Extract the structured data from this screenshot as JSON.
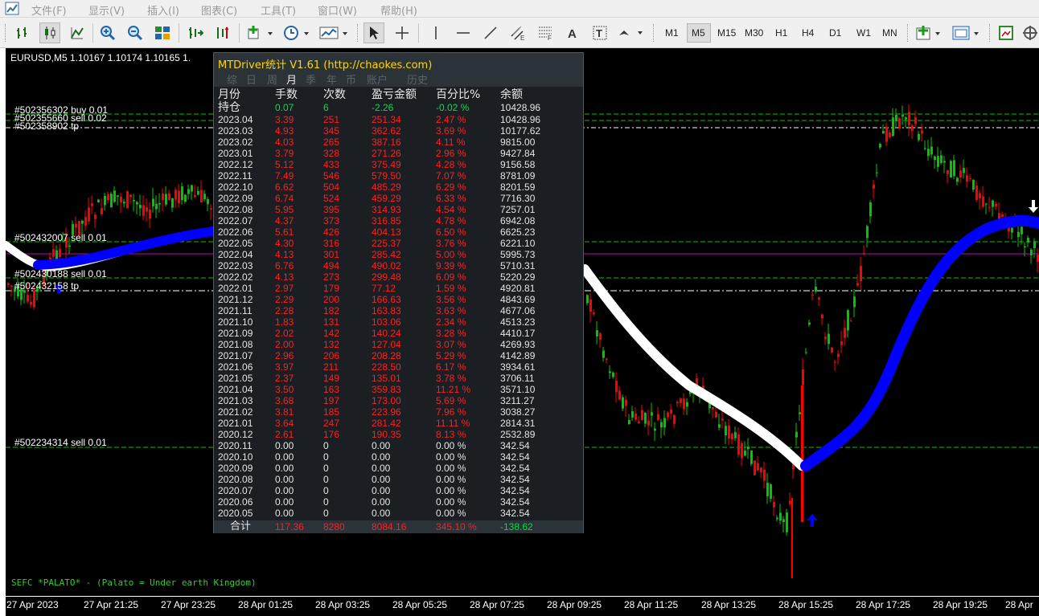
{
  "menubar": {
    "items": [
      "文件(F)",
      "显示(V)",
      "插入(I)",
      "图表(C)",
      "工具(T)",
      "窗口(W)",
      "帮助(H)"
    ]
  },
  "toolbar": {
    "timeframes": [
      "M1",
      "M5",
      "M15",
      "M30",
      "H1",
      "H4",
      "D1",
      "W1",
      "MN"
    ],
    "active_timeframe": "M5",
    "tools": [
      "bar-chart-icon",
      "candlestick-icon",
      "line-chart-icon",
      "zoom-in-icon",
      "zoom-out-icon",
      "tile-windows-icon",
      "auto-scroll-icon",
      "chart-shift-icon",
      "indicators-icon",
      "periods-icon",
      "templates-icon",
      "cursor-icon",
      "crosshair-icon",
      "vertical-line-icon",
      "horizontal-line-icon",
      "trendline-icon",
      "fibonacci-icon",
      "channel-icon",
      "text-icon",
      "text-label-icon",
      "arrows-icon",
      "new-chart-icon",
      "profiles-icon",
      "screenshot-icon",
      "strategy-tester-icon"
    ]
  },
  "chart": {
    "symbol_info": "EURUSD,M5  1.10167 1.10174 1.10165 1.",
    "order_labels": [
      "#502356302 buy 0.01",
      "#502355660 sell 0.02",
      "#502358902 tp",
      "#502432007 sell 0.01",
      "#502430188 sell 0.01",
      "#502432158 tp",
      "#502234314 sell 0.01"
    ],
    "comment": "SEFC *PALATO* - (Palato = Under earth Kingdom)",
    "time_labels": [
      "27 Apr 2023",
      "27 Apr 21:25",
      "27 Apr 23:25",
      "28 Apr 01:25",
      "28 Apr 03:25",
      "28 Apr 05:25",
      "28 Apr 07:25",
      "28 Apr 09:25",
      "28 Apr 11:25",
      "28 Apr 13:25",
      "28 Apr 15:25",
      "28 Apr 17:25",
      "28 Apr 19:25",
      "28 Apr"
    ],
    "colors": {
      "bull": "#00c800",
      "bear": "#ff0000",
      "ma_up": "#0000ff",
      "ma_down": "#ffffff",
      "order_line": "#00c800",
      "tp_line": "#ffffff",
      "price_line": "#c000c0",
      "comment": "#32cd32"
    }
  },
  "stats": {
    "title": "MTDriver统计 V1.61  (http://chaokes.com)",
    "tabs": [
      "综",
      "日",
      "周",
      "月",
      "季",
      "年",
      "币",
      "账户",
      "历史"
    ],
    "active_tab": "月",
    "headers": [
      "月份",
      "手数",
      "次数",
      "盈亏金额",
      "百分比%",
      "余额"
    ],
    "holding": [
      "持仓",
      "0.07",
      "6",
      "-2.26",
      "-0.02 %",
      "10428.96"
    ],
    "rows": [
      [
        "2023.04",
        "3.39",
        "251",
        "251.34",
        "2.47 %",
        "10428.96"
      ],
      [
        "2023.03",
        "4.93",
        "345",
        "362.62",
        "3.69 %",
        "10177.62"
      ],
      [
        "2023.02",
        "4.03",
        "265",
        "387.16",
        "4.11 %",
        "9815.00"
      ],
      [
        "2023.01",
        "3.79",
        "328",
        "271.26",
        "2.96 %",
        "9427.84"
      ],
      [
        "2022.12",
        "5.12",
        "433",
        "375.49",
        "4.28 %",
        "9156.58"
      ],
      [
        "2022.11",
        "7.49",
        "546",
        "579.50",
        "7.07 %",
        "8781.09"
      ],
      [
        "2022.10",
        "6.62",
        "504",
        "485.29",
        "6.29 %",
        "8201.59"
      ],
      [
        "2022.09",
        "6.74",
        "524",
        "459.29",
        "6.33 %",
        "7716.30"
      ],
      [
        "2022.08",
        "5.95",
        "395",
        "314.93",
        "4.54 %",
        "7257.01"
      ],
      [
        "2022.07",
        "4.37",
        "373",
        "316.85",
        "4.78 %",
        "6942.08"
      ],
      [
        "2022.06",
        "5.61",
        "426",
        "404.13",
        "6.50 %",
        "6625.23"
      ],
      [
        "2022.05",
        "4.30",
        "316",
        "225.37",
        "3.76 %",
        "6221.10"
      ],
      [
        "2022.04",
        "4.13",
        "301",
        "285.42",
        "5.00 %",
        "5995.73"
      ],
      [
        "2022.03",
        "6.76",
        "494",
        "490.02",
        "9.39 %",
        "5710.31"
      ],
      [
        "2022.02",
        "4.13",
        "273",
        "299.48",
        "6.09 %",
        "5220.29"
      ],
      [
        "2022.01",
        "2.97",
        "179",
        "77.12",
        "1.59 %",
        "4920.81"
      ],
      [
        "2021.12",
        "2.29",
        "200",
        "166.63",
        "3.56 %",
        "4843.69"
      ],
      [
        "2021.11",
        "2.28",
        "182",
        "163.83",
        "3.63 %",
        "4677.06"
      ],
      [
        "2021.10",
        "1.83",
        "131",
        "103.06",
        "2.34 %",
        "4513.23"
      ],
      [
        "2021.09",
        "2.02",
        "142",
        "140.24",
        "3.28 %",
        "4410.17"
      ],
      [
        "2021.08",
        "2.00",
        "132",
        "127.04",
        "3.07 %",
        "4269.93"
      ],
      [
        "2021.07",
        "2.96",
        "206",
        "208.28",
        "5.29 %",
        "4142.89"
      ],
      [
        "2021.06",
        "3.97",
        "211",
        "228.50",
        "6.17 %",
        "3934.61"
      ],
      [
        "2021.05",
        "2.37",
        "149",
        "135.01",
        "3.78 %",
        "3706.11"
      ],
      [
        "2021.04",
        "3.50",
        "163",
        "359.83",
        "11.21 %",
        "3571.10"
      ],
      [
        "2021.03",
        "3.68",
        "197",
        "173.00",
        "5.69 %",
        "3211.27"
      ],
      [
        "2021.02",
        "3.81",
        "185",
        "223.96",
        "7.96 %",
        "3038.27"
      ],
      [
        "2021.01",
        "3.64",
        "247",
        "281.42",
        "11.11 %",
        "2814.31"
      ],
      [
        "2020.12",
        "2.61",
        "176",
        "190.35",
        "8.13 %",
        "2532.89"
      ],
      [
        "2020.11",
        "0.00",
        "0",
        "0.00",
        "0.00 %",
        "342.54"
      ],
      [
        "2020.10",
        "0.00",
        "0",
        "0.00",
        "0.00 %",
        "342.54"
      ],
      [
        "2020.09",
        "0.00",
        "0",
        "0.00",
        "0.00 %",
        "342.54"
      ],
      [
        "2020.08",
        "0.00",
        "0",
        "0.00",
        "0.00 %",
        "342.54"
      ],
      [
        "2020.07",
        "0.00",
        "0",
        "0.00",
        "0.00 %",
        "342.54"
      ],
      [
        "2020.06",
        "0.00",
        "0",
        "0.00",
        "0.00 %",
        "342.54"
      ],
      [
        "2020.05",
        "0.00",
        "0",
        "0.00",
        "0.00 %",
        "342.54"
      ]
    ],
    "total": [
      "合计",
      "117.36",
      "8280",
      "8084.16",
      "345.10 %",
      "-138.62"
    ]
  }
}
